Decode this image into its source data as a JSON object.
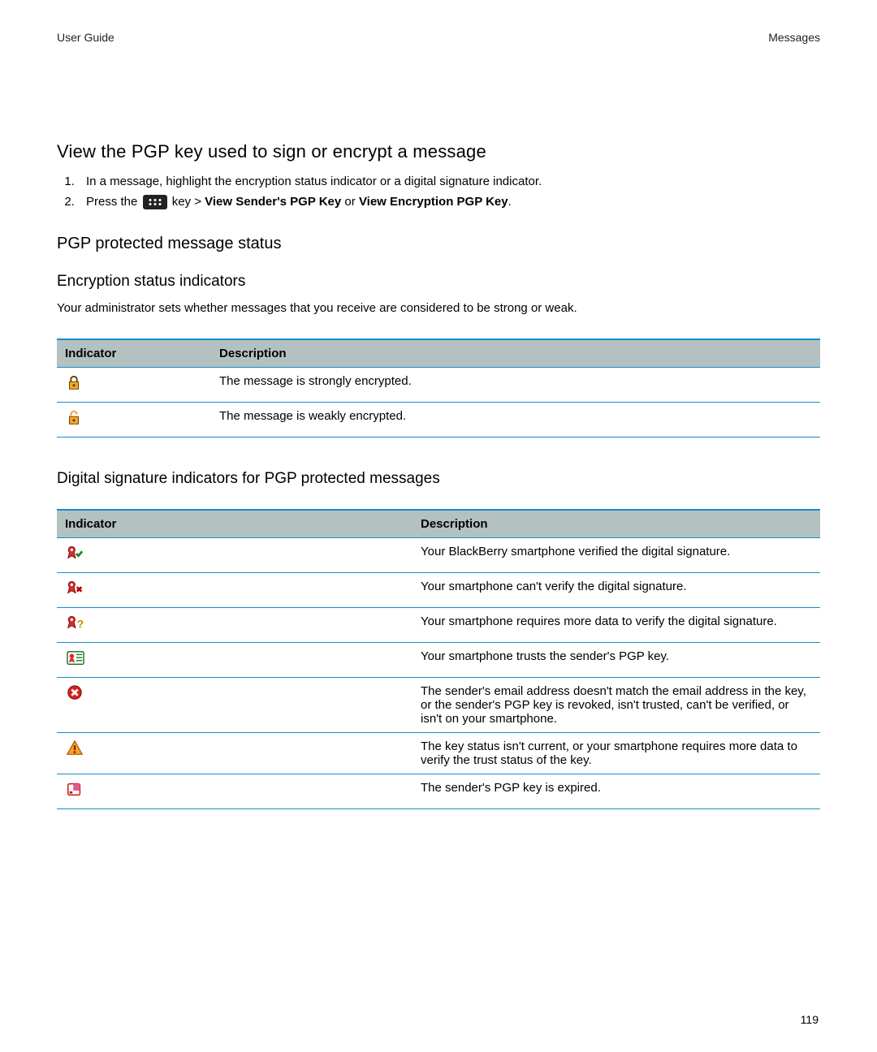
{
  "header": {
    "left": "User Guide",
    "right": "Messages"
  },
  "section_view_pgp": {
    "title": "View the PGP key used to sign or encrypt a message",
    "step1": "In a message, highlight the encryption status indicator or a digital signature indicator.",
    "step2_a": "Press the ",
    "step2_b": " key > ",
    "step2_c": "View Sender's PGP Key",
    "step2_d": " or ",
    "step2_e": "View Encryption PGP Key",
    "step2_f": "."
  },
  "section_status": {
    "title": "PGP protected message status"
  },
  "section_enc": {
    "title": "Encryption status indicators",
    "intro": "Your administrator sets whether messages that you receive are considered to be strong or weak.",
    "table": {
      "col_indicator": "Indicator",
      "col_description": "Description",
      "rows": [
        {
          "icon": "lock-strong-icon",
          "desc": "The message is strongly encrypted."
        },
        {
          "icon": "lock-weak-icon",
          "desc": "The message is weakly encrypted."
        }
      ]
    }
  },
  "section_sig": {
    "title": "Digital signature indicators for PGP protected messages",
    "table": {
      "col_indicator": "Indicator",
      "col_description": "Description",
      "rows": [
        {
          "icon": "ribbon-check-icon",
          "desc": "Your BlackBerry smartphone verified the digital signature."
        },
        {
          "icon": "ribbon-x-icon",
          "desc": "Your smartphone can't verify the digital signature."
        },
        {
          "icon": "ribbon-question-icon",
          "desc": "Your smartphone requires more data to verify the digital signature."
        },
        {
          "icon": "key-trusted-icon",
          "desc": "Your smartphone trusts the sender's PGP key."
        },
        {
          "icon": "error-circle-icon",
          "desc": "The sender's email address doesn't match the email address in the key, or the sender's PGP key is revoked, isn't trusted, can't be verified, or isn't on your smartphone."
        },
        {
          "icon": "warning-triangle-icon",
          "desc": "The key status isn't current, or your smartphone requires more data to verify the trust status of the key."
        },
        {
          "icon": "expired-card-icon",
          "desc": "The sender's PGP key is expired."
        }
      ]
    }
  },
  "page_number": "119"
}
